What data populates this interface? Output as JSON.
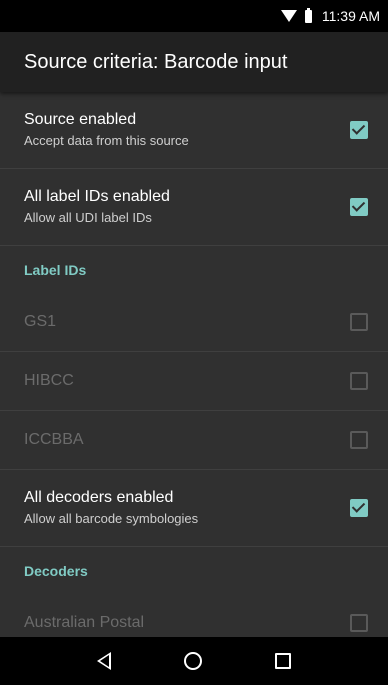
{
  "status_bar": {
    "time": "11:39 AM"
  },
  "app_bar": {
    "title": "Source criteria: Barcode input"
  },
  "settings": {
    "source_enabled": {
      "title": "Source enabled",
      "subtitle": "Accept data from this source",
      "checked": true
    },
    "all_label_ids": {
      "title": "All label IDs enabled",
      "subtitle": "Allow all UDI label IDs",
      "checked": true
    },
    "label_ids_header": "Label IDs",
    "label_ids": [
      {
        "title": "GS1",
        "checked": false,
        "enabled": false
      },
      {
        "title": "HIBCC",
        "checked": false,
        "enabled": false
      },
      {
        "title": "ICCBBA",
        "checked": false,
        "enabled": false
      }
    ],
    "all_decoders": {
      "title": "All decoders enabled",
      "subtitle": "Allow all barcode symbologies",
      "checked": true
    },
    "decoders_header": "Decoders",
    "decoders": [
      {
        "title": "Australian Postal",
        "checked": false,
        "enabled": false
      }
    ]
  },
  "colors": {
    "accent": "#80cbc4",
    "background": "#303030",
    "app_bar": "#212121"
  },
  "nav": {
    "back_icon": "back-triangle-icon",
    "home_icon": "home-circle-icon",
    "recent_icon": "recent-square-icon"
  }
}
